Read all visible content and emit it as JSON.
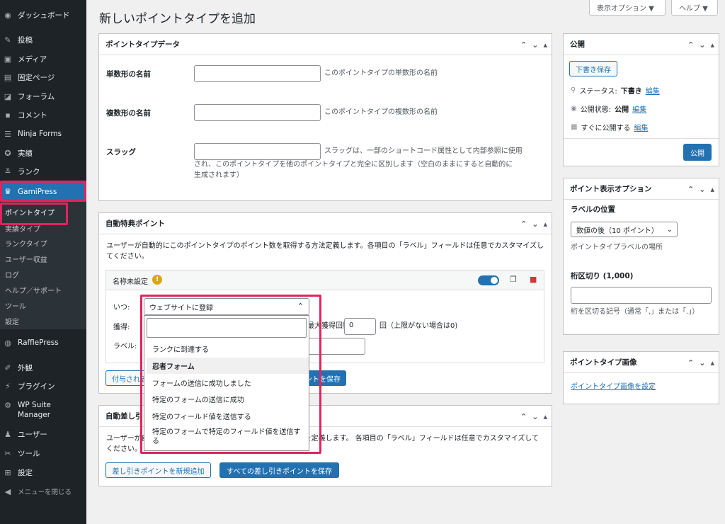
{
  "sidebar": {
    "items": [
      {
        "label": "ダッシュボード",
        "icon": "dashboard-icon"
      },
      {
        "label": "投稿",
        "icon": "pin-icon"
      },
      {
        "label": "メディア",
        "icon": "media-icon"
      },
      {
        "label": "固定ページ",
        "icon": "page-icon"
      },
      {
        "label": "フォーラム",
        "icon": "forum-icon"
      },
      {
        "label": "コメント",
        "icon": "comment-icon"
      },
      {
        "label": "Ninja Forms",
        "icon": "forms-icon"
      },
      {
        "label": "実績",
        "icon": "award-icon"
      },
      {
        "label": "ランク",
        "icon": "rank-icon"
      },
      {
        "label": "GamiPress",
        "icon": "crown-icon"
      }
    ],
    "submenu": [
      "ポイントタイプ",
      "実績タイプ",
      "ランクタイプ",
      "ユーザー収益",
      "ログ",
      "ヘルプ／サポート",
      "ツール",
      "設定"
    ],
    "items2": [
      {
        "label": "RafflePress",
        "icon": "raffle-icon"
      },
      {
        "label": "外観",
        "icon": "brush-icon"
      },
      {
        "label": "プラグイン",
        "icon": "plugin-icon"
      },
      {
        "label": "WP Suite Manager",
        "icon": "gear-icon"
      },
      {
        "label": "ユーザー",
        "icon": "users-icon"
      },
      {
        "label": "ツール",
        "icon": "wrench-icon"
      },
      {
        "label": "設定",
        "icon": "settings-icon"
      },
      {
        "label": "メニューを閉じる",
        "icon": "collapse-icon"
      }
    ]
  },
  "header": {
    "title": "新しいポイントタイプを追加",
    "screen_options": "表示オプション ▼",
    "help": "ヘルプ ▼"
  },
  "point_data": {
    "title": "ポイントタイプデータ",
    "singular_label": "単数形の名前",
    "singular_desc": "このポイントタイプの単数形の名前",
    "plural_label": "複数形の名前",
    "plural_desc": "このポイントタイプの複数形の名前",
    "slug_label": "スラッグ",
    "slug_desc_1": "スラッグは、一部のショートコード属性として内部参照に使用",
    "slug_desc_2": "され、このポイントタイプを他のポイントタイプと完全に区別します（空白のままにすると自動的に",
    "slug_desc_3": "生成されます）"
  },
  "auto_award": {
    "title": "自動特典ポイント",
    "desc": "ユーザーが自動的にこのポイントタイプのポイント数を取得する方法定義します。各項目の「ラベル」フィールドは任意でカスタマイズしてください。",
    "item_title": "名称未設定",
    "when_label": "いつ:",
    "when_value": "ウェブサイトに登録",
    "earn_label": "獲得:",
    "max_label": "最大獲得回数",
    "max_value": "0",
    "max_suffix": "回（上限がない場合は0)",
    "label_label": "ラベル:",
    "add_button": "付与されるポイントを新規追加",
    "save_button": "すべての付与ポイントを保存"
  },
  "dropdown": {
    "options": [
      {
        "label": "ランクに到達する",
        "group": false
      },
      {
        "label": "忍者フォーム",
        "group": true
      },
      {
        "label": "フォームの送信に成功しました",
        "group": false
      },
      {
        "label": "特定のフォームの送信に成功",
        "group": false
      },
      {
        "label": "特定のフィールド値を送信する",
        "group": false
      },
      {
        "label": "特定のフォームで特定のフィールド値を送信する",
        "group": false
      }
    ]
  },
  "auto_deduct": {
    "title": "自動差し引きポイント",
    "desc": "ユーザーが自動的にこのポイントタイプのポイントを失う方法を定義します。 各項目の「ラベル」フィールドは任意でカスタマイズしてください。",
    "add_button": "差し引きポイントを新規追加",
    "save_button": "すべての差し引きポイントを保存"
  },
  "publish": {
    "title": "公開",
    "draft_button": "下書き保存",
    "status_label": "ステータス:",
    "status_value": "下書き",
    "visibility_label": "公開状態:",
    "visibility_value": "公開",
    "schedule_label": "すぐに公開する",
    "edit": "編集",
    "publish_button": "公開"
  },
  "display_options": {
    "title": "ポイント表示オプション",
    "label_position": "ラベルの位置",
    "select_value": "数値の後（10 ポイント）",
    "select_desc": "ポイントタイプラベルの場所",
    "thousands_label": "桁区切り (1,000)",
    "thousands_desc": "桁を区切る記号（通常「,」または「.」）"
  },
  "image": {
    "title": "ポイントタイプ画像",
    "link": "ポイントタイプ画像を設定"
  },
  "colors": {
    "accent": "#2271b1",
    "highlight": "#e0245e",
    "sidebar": "#1d2327"
  }
}
